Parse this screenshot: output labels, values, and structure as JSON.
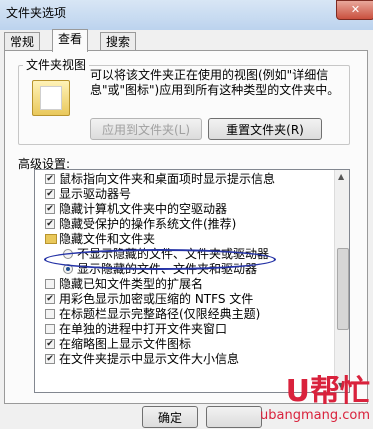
{
  "window": {
    "title": "文件夹选项",
    "close_glyph": "✕"
  },
  "tabs": [
    {
      "label": "常规"
    },
    {
      "label": "查看"
    },
    {
      "label": "搜索"
    }
  ],
  "folder_views": {
    "legend": "文件夹视图",
    "description": "可以将该文件夹正在使用的视图(例如\"详细信息\"或\"图标\")应用到所有这种类型的文件夹中。",
    "apply_button": "应用到文件夹(L)",
    "reset_button": "重置文件夹(R)"
  },
  "advanced": {
    "label": "高级设置:",
    "items": [
      {
        "kind": "checkbox",
        "checked": true,
        "label": "鼠标指向文件夹和桌面项时显示提示信息"
      },
      {
        "kind": "checkbox",
        "checked": true,
        "label": "显示驱动器号"
      },
      {
        "kind": "checkbox",
        "checked": true,
        "label": "隐藏计算机文件夹中的空驱动器"
      },
      {
        "kind": "checkbox",
        "checked": true,
        "label": "隐藏受保护的操作系统文件(推荐)"
      },
      {
        "kind": "folder",
        "label": "隐藏文件和文件夹"
      },
      {
        "kind": "radio",
        "selected": false,
        "label": "不显示隐藏的文件、文件夹或驱动器"
      },
      {
        "kind": "radio",
        "selected": true,
        "label": "显示隐藏的文件、文件夹和驱动器"
      },
      {
        "kind": "checkbox",
        "checked": false,
        "label": "隐藏已知文件类型的扩展名"
      },
      {
        "kind": "checkbox",
        "checked": true,
        "label": "用彩色显示加密或压缩的 NTFS 文件"
      },
      {
        "kind": "checkbox",
        "checked": false,
        "label": "在标题栏显示完整路径(仅限经典主题)"
      },
      {
        "kind": "checkbox",
        "checked": false,
        "label": "在单独的进程中打开文件夹窗口"
      },
      {
        "kind": "checkbox",
        "checked": true,
        "label": "在缩略图上显示文件图标"
      },
      {
        "kind": "checkbox",
        "checked": true,
        "label": "在文件夹提示中显示文件大小信息"
      }
    ]
  },
  "footer": {
    "ok_button": "确定"
  },
  "watermark": {
    "brand": "U帮忙",
    "url": "ubangmang.com"
  },
  "colors": {
    "accent_ellipse": "#2533a6",
    "watermark": "#d9223c"
  }
}
